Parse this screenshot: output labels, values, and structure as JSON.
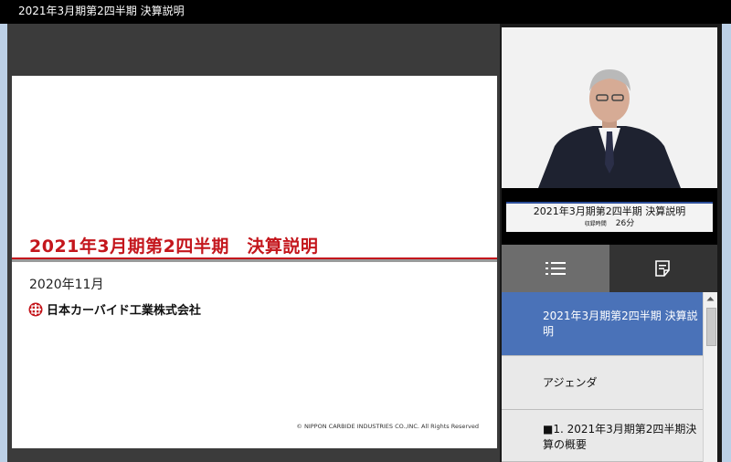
{
  "window": {
    "title": "2021年3月期第2四半期 決算説明"
  },
  "slide": {
    "title": "2021年3月期第2四半期　決算説明",
    "date": "2020年11月",
    "company": "日本カーバイド工業株式会社",
    "copyright": "© NIPPON CARBIDE INDUSTRIES CO.,INC. All Rights Reserved"
  },
  "video_caption": {
    "title": "2021年3月期第2四半期 決算説明",
    "duration_label": "収録時間",
    "duration_value": "26分"
  },
  "tabs": [
    {
      "icon": "list-icon",
      "active": true
    },
    {
      "icon": "document-icon",
      "active": false
    }
  ],
  "chapters": [
    {
      "label": "2021年3月期第2四半期 決算説明",
      "active": true
    },
    {
      "label": "アジェンダ",
      "active": false
    },
    {
      "label": "■1. 2021年3月期第2四半期決算の概要",
      "active": false
    }
  ],
  "colors": {
    "accent_red": "#c4161c",
    "active_chapter": "#4a72b8",
    "caption_border": "#2d4f9a"
  }
}
